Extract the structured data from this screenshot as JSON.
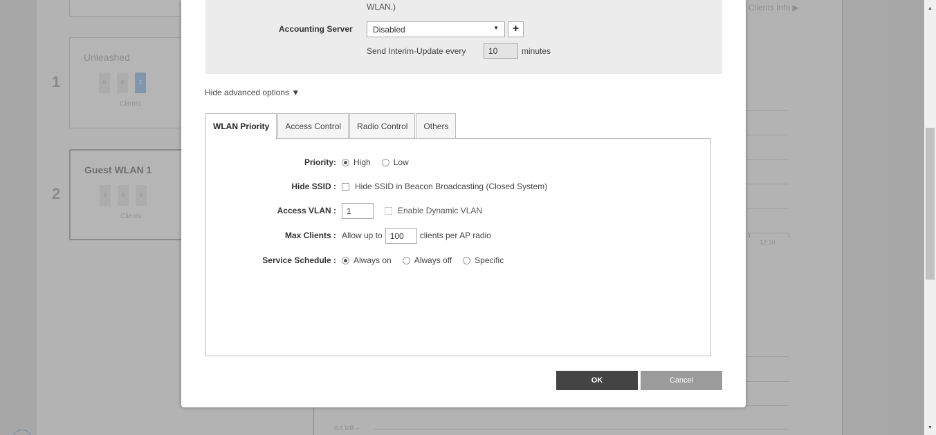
{
  "background": {
    "cards": [
      {
        "number": "1",
        "title": "Unleashed",
        "counts": [
          "0",
          "0",
          "2"
        ],
        "clients_label": "Clients"
      },
      {
        "number": "2",
        "title": "Guest WLAN 1",
        "counts": [
          "0",
          "0",
          "0"
        ],
        "clients_label": "Clients"
      }
    ],
    "clients_info": "Clients Info ▶",
    "time_label": "12:30",
    "size_label": "0.4 MB –"
  },
  "modal": {
    "wlan_note": "WLAN.)",
    "accounting": {
      "label": "Accounting Server",
      "value": "Disabled",
      "add_icon": "plus-icon",
      "interim_prefix": "Send Interim-Update every",
      "interim_value": "10",
      "interim_unit": "minutes"
    },
    "advanced_toggle": "Hide advanced options ▼",
    "tabs": [
      {
        "label": "WLAN Priority",
        "active": true
      },
      {
        "label": "Access Control",
        "active": false
      },
      {
        "label": "Radio Control",
        "active": false
      },
      {
        "label": "Others",
        "active": false
      }
    ],
    "fields": {
      "priority": {
        "label": "Priority:",
        "options": [
          "High",
          "Low"
        ],
        "selected": "High"
      },
      "hide_ssid": {
        "label": "Hide SSID :",
        "checkbox_text": "Hide SSID in Beacon Broadcasting (Closed System)",
        "checked": false
      },
      "access_vlan": {
        "label": "Access VLAN :",
        "value": "1",
        "dynamic_label": "Enable Dynamic VLAN"
      },
      "max_clients": {
        "label": "Max Clients :",
        "prefix": "Allow up to",
        "value": "100",
        "suffix": "clients per AP radio"
      },
      "service_schedule": {
        "label": "Service Schedule :",
        "options": [
          "Always on",
          "Always off",
          "Specific"
        ],
        "selected": "Always on"
      }
    },
    "buttons": {
      "ok": "OK",
      "cancel": "Cancel"
    }
  }
}
